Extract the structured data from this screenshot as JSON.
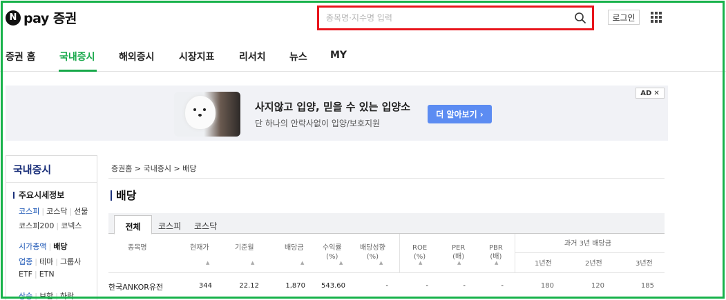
{
  "header": {
    "logo_letter": "N",
    "logo_text": "pay 증권",
    "search_placeholder": "종목명·지수명 입력",
    "login_label": "로그인"
  },
  "nav": {
    "items": [
      "증권 홈",
      "국내증시",
      "해외증시",
      "시장지표",
      "리서치",
      "뉴스",
      "MY"
    ],
    "active": "국내증시"
  },
  "ad": {
    "title": "사지않고 입양, 믿을 수 있는 입양소",
    "subtitle": "단 하나의 안락사없이 입양/보호지원",
    "button_label": "더 알아보기 ›",
    "badge": "AD",
    "close": "✕"
  },
  "sidebar": {
    "title": "국내증시",
    "section": "주요시세정보",
    "rows": [
      [
        "코스피",
        "코스닥",
        "선물"
      ],
      [
        "코스피200",
        "코넥스"
      ],
      [
        "시가총액",
        "배당"
      ],
      [
        "업종",
        "테마",
        "그룹사"
      ],
      [
        "ETF",
        "ETN"
      ],
      [
        "상승",
        "보합",
        "하락"
      ]
    ]
  },
  "main": {
    "breadcrumb": "증권홈 > 국내증시 > 배당",
    "title": "배당",
    "tabs": [
      "전체",
      "코스피",
      "코스닥"
    ],
    "active_tab": "전체",
    "columns": {
      "name": "종목명",
      "price": "현재가",
      "base_month": "기준월",
      "dividend": "배당금",
      "yield": "수익률\n(%)",
      "payout": "배당성향\n(%)",
      "roe": "ROE\n(%)",
      "per": "PER\n(배)",
      "pbr": "PBR\n(배)",
      "past_group": "과거 3년 배당금",
      "y1": "1년전",
      "y2": "2년전",
      "y3": "3년전"
    },
    "rows": [
      {
        "name": "한국ANKOR유전",
        "price": "344",
        "base_month": "22.12",
        "dividend": "1,870",
        "yield": "543.60",
        "payout": "-",
        "roe": "-",
        "per": "-",
        "pbr": "-",
        "y1": "180",
        "y2": "120",
        "y3": "185"
      }
    ]
  },
  "colors": {
    "accent_green": "#17a84a",
    "frame_green": "#17b24a",
    "search_red": "#e8141b",
    "navy": "#1a2f7a",
    "ad_button": "#5c8cf2"
  }
}
